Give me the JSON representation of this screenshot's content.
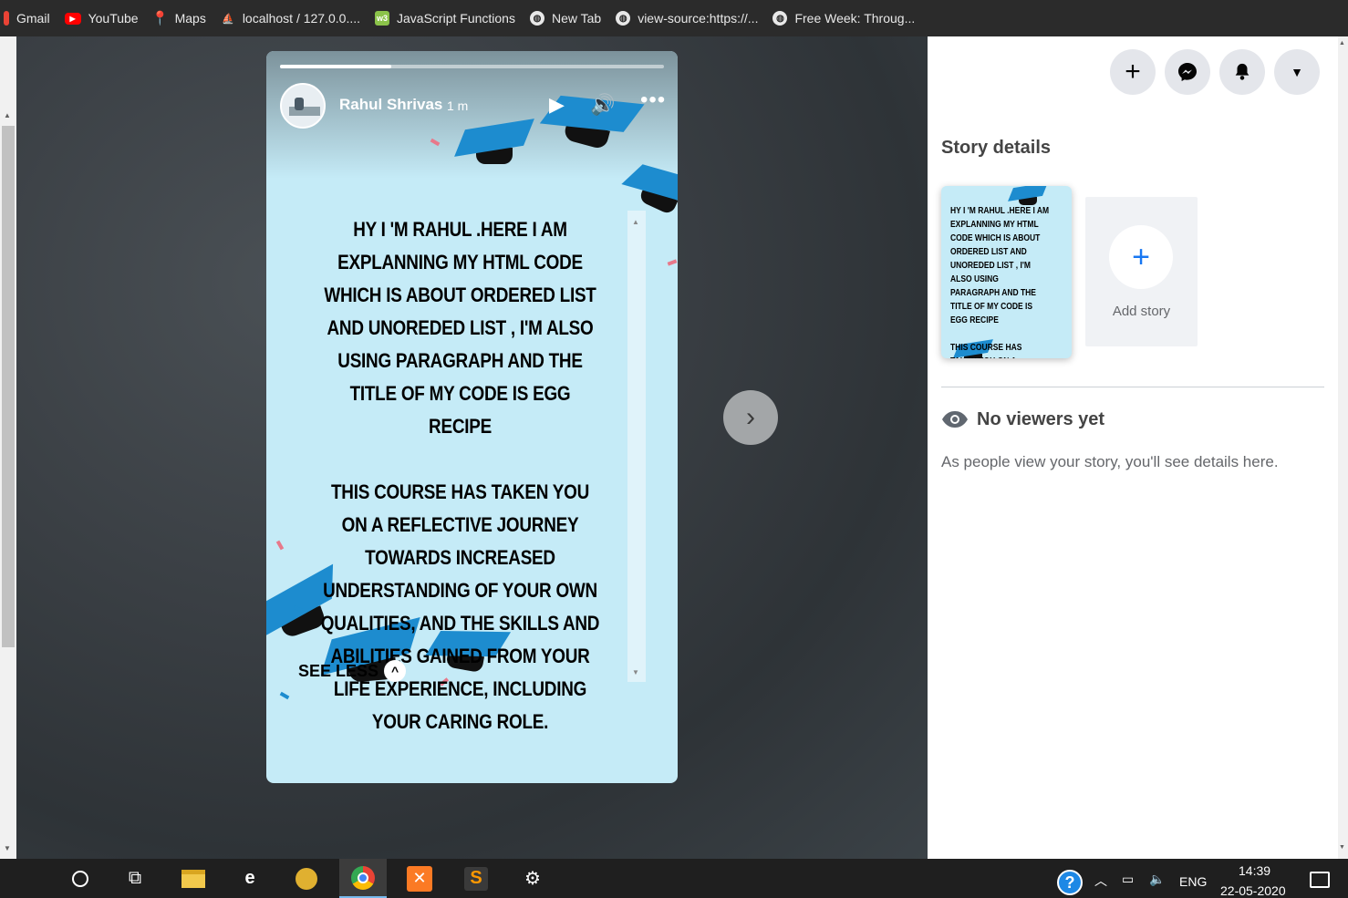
{
  "bookmarks": [
    {
      "label": "Gmail",
      "icon": "gmail-icon"
    },
    {
      "label": "YouTube",
      "icon": "youtube-icon"
    },
    {
      "label": "Maps",
      "icon": "maps-icon"
    },
    {
      "label": "localhost / 127.0.0....",
      "icon": "phpmyadmin-icon"
    },
    {
      "label": "JavaScript Functions",
      "icon": "w3schools-icon"
    },
    {
      "label": "New Tab",
      "icon": "globe-icon"
    },
    {
      "label": "view-source:https://...",
      "icon": "globe-icon"
    },
    {
      "label": "Free Week: Throug...",
      "icon": "globe-icon"
    }
  ],
  "story": {
    "author": "Rahul Shrivas",
    "time": "1 m",
    "progress": 0.29,
    "text": "HY I 'M RAHUL .HERE I AM EXPLANNING MY HTML CODE WHICH IS ABOUT ORDERED LIST  AND UNOREDED LIST , I'M ALSO USING PARAGRAPH AND THE TITLE OF MY CODE IS EGG  RECIPE\n\nTHIS COURSE HAS TAKEN YOU ON A REFLECTIVE JOURNEY TOWARDS INCREASED UNDERSTANDING OF YOUR OWN QUALITIES, AND THE SKILLS AND ABILITIES GAINED FROM YOUR LIFE EXPERIENCE, INCLUDING YOUR CARING ROLE.",
    "see_less": "SEE LESS",
    "background": "#c5ebf7",
    "cap_color": "#1d8ccf"
  },
  "panel": {
    "title": "Story details",
    "thumb_text": "HY I 'M RAHUL .HERE I AM EXPLANNING MY HTML CODE WHICH IS ABOUT ORDERED LIST  AND UNOREDED LIST , I'M ALSO USING PARAGRAPH AND THE TITLE OF MY CODE IS EGG  RECIPE\n\nTHIS COURSE HAS TAKEN YOU ON A REFLECTIVE ...",
    "add_story": "Add story",
    "viewers_title": "No viewers yet",
    "viewers_desc": "As people view your story, you'll see details here.",
    "accent": "#1877f2"
  },
  "taskbar": {
    "lang": "ENG",
    "time": "14:39",
    "date": "22-05-2020"
  }
}
